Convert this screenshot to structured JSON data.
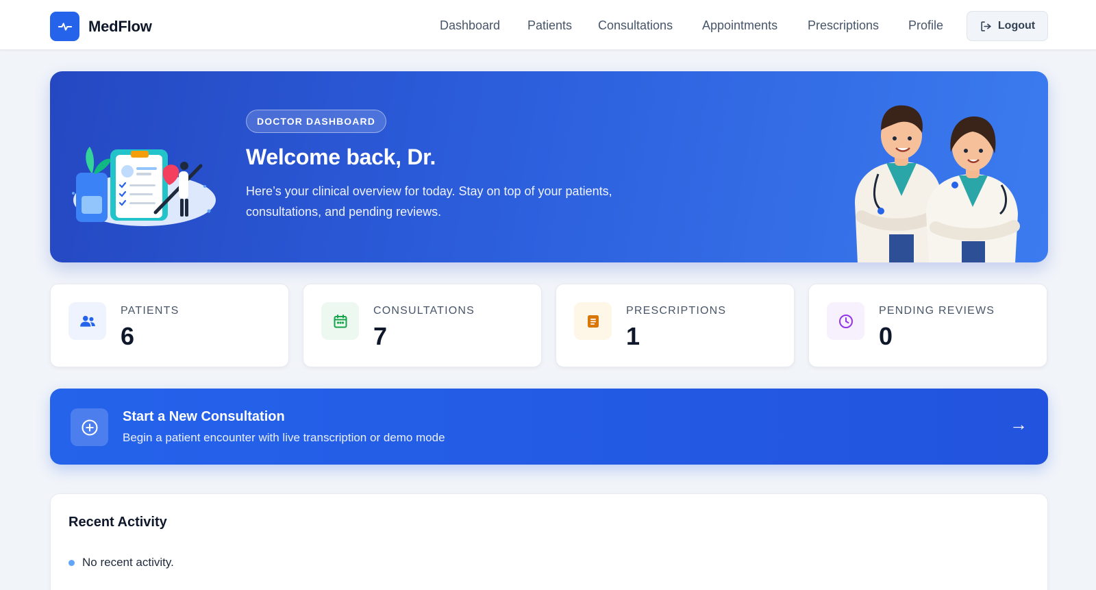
{
  "app": {
    "name": "MedFlow"
  },
  "nav": {
    "items": [
      {
        "label": "Dashboard"
      },
      {
        "label": "Patients"
      },
      {
        "label": "Consultations"
      },
      {
        "label": "Appointments"
      },
      {
        "label": "Prescriptions"
      },
      {
        "label": "Profile"
      }
    ],
    "logout_label": "Logout"
  },
  "hero": {
    "badge": "DOCTOR DASHBOARD",
    "title": "Welcome back, Dr.",
    "subtitle": "Here’s your clinical overview for today. Stay on top of your patients, consultations, and pending reviews."
  },
  "stats": [
    {
      "label": "PATIENTS",
      "value": "6",
      "icon": "users-icon",
      "color": "#2563eb",
      "bg": "#eef3fe"
    },
    {
      "label": "CONSULTATIONS",
      "value": "7",
      "icon": "calendar-icon",
      "color": "#16a34a",
      "bg": "#ecf8f0"
    },
    {
      "label": "PRESCRIPTIONS",
      "value": "1",
      "icon": "document-icon",
      "color": "#d97706",
      "bg": "#fef6e7"
    },
    {
      "label": "PENDING REVIEWS",
      "value": "0",
      "icon": "clock-icon",
      "color": "#9333ea",
      "bg": "#f7f0fd"
    }
  ],
  "cta": {
    "title": "Start a New Consultation",
    "subtitle": "Begin a patient encounter with live transcription or demo mode",
    "arrow": "→"
  },
  "activity": {
    "title": "Recent Activity",
    "items": [
      {
        "text": "No recent activity."
      }
    ]
  },
  "colors": {
    "primary": "#2563eb",
    "background": "#f1f4f9",
    "hero_start": "#2548c2",
    "hero_end": "#3b7bef"
  }
}
